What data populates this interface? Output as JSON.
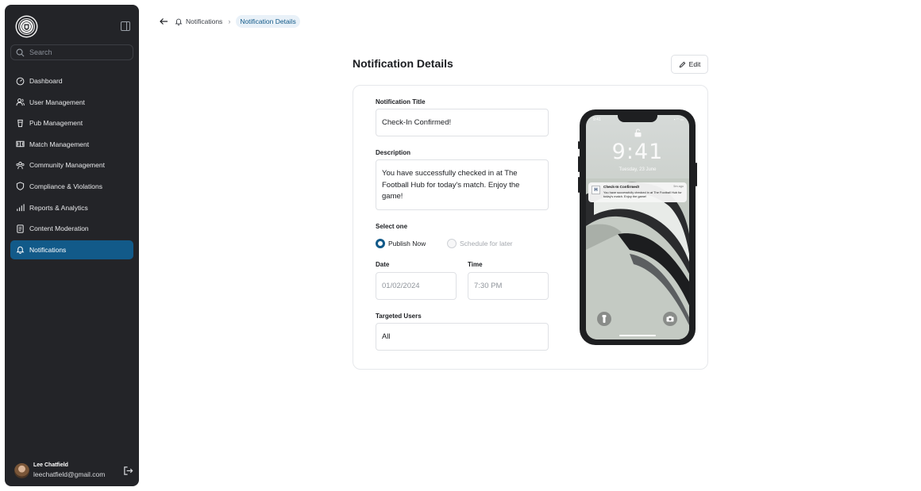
{
  "sidebar": {
    "search_placeholder": "Search",
    "items": [
      {
        "label": "Dashboard",
        "icon": "dashboard-icon",
        "active": false
      },
      {
        "label": "User Management",
        "icon": "users-icon",
        "active": false
      },
      {
        "label": "Pub Management",
        "icon": "pint-glass-icon",
        "active": false
      },
      {
        "label": "Match Management",
        "icon": "pitch-icon",
        "active": false
      },
      {
        "label": "Community Management",
        "icon": "community-icon",
        "active": false
      },
      {
        "label": "Compliance & Violations",
        "icon": "shield-icon",
        "active": false
      },
      {
        "label": "Reports & Analytics",
        "icon": "bar-chart-icon",
        "active": false
      },
      {
        "label": "Content Moderation",
        "icon": "document-icon",
        "active": false
      },
      {
        "label": "Notifications",
        "icon": "bell-icon",
        "active": true
      }
    ],
    "user": {
      "name": "Lee Chatfield",
      "email": "leechatfield@gmail.com"
    }
  },
  "breadcrumb": {
    "parent": "Notifications",
    "current": "Notification Details"
  },
  "page": {
    "title": "Notification Details",
    "edit_label": "Edit"
  },
  "form": {
    "title_label": "Notification Title",
    "title_value": "Check-In Confirmed!",
    "description_label": "Description",
    "description_value": "You have successfully checked in at The Football Hub for today's match. Enjoy the game!",
    "select_label": "Select one",
    "option_publish": "Publish Now",
    "option_schedule": "Schedule for later",
    "selected_option": "Publish Now",
    "date_label": "Date",
    "date_value": "01/02/2024",
    "time_label": "Time",
    "time_value": "7:30 PM",
    "targeted_label": "Targeted Users",
    "targeted_value": "All"
  },
  "preview": {
    "clock": "9:41",
    "date": "Tuesday, 23 June",
    "status_time": "9:41",
    "app_badge": "H",
    "notification_title": "Check-In Confirmed!",
    "notification_when": "5m ago",
    "notification_body": "You have successfully checked in at The Football Hub for today's match. Enjoy the game!"
  },
  "colors": {
    "sidebar_bg": "#232428",
    "accent": "#125a89",
    "breadcrumb_chip_bg": "#e9f1f8"
  }
}
